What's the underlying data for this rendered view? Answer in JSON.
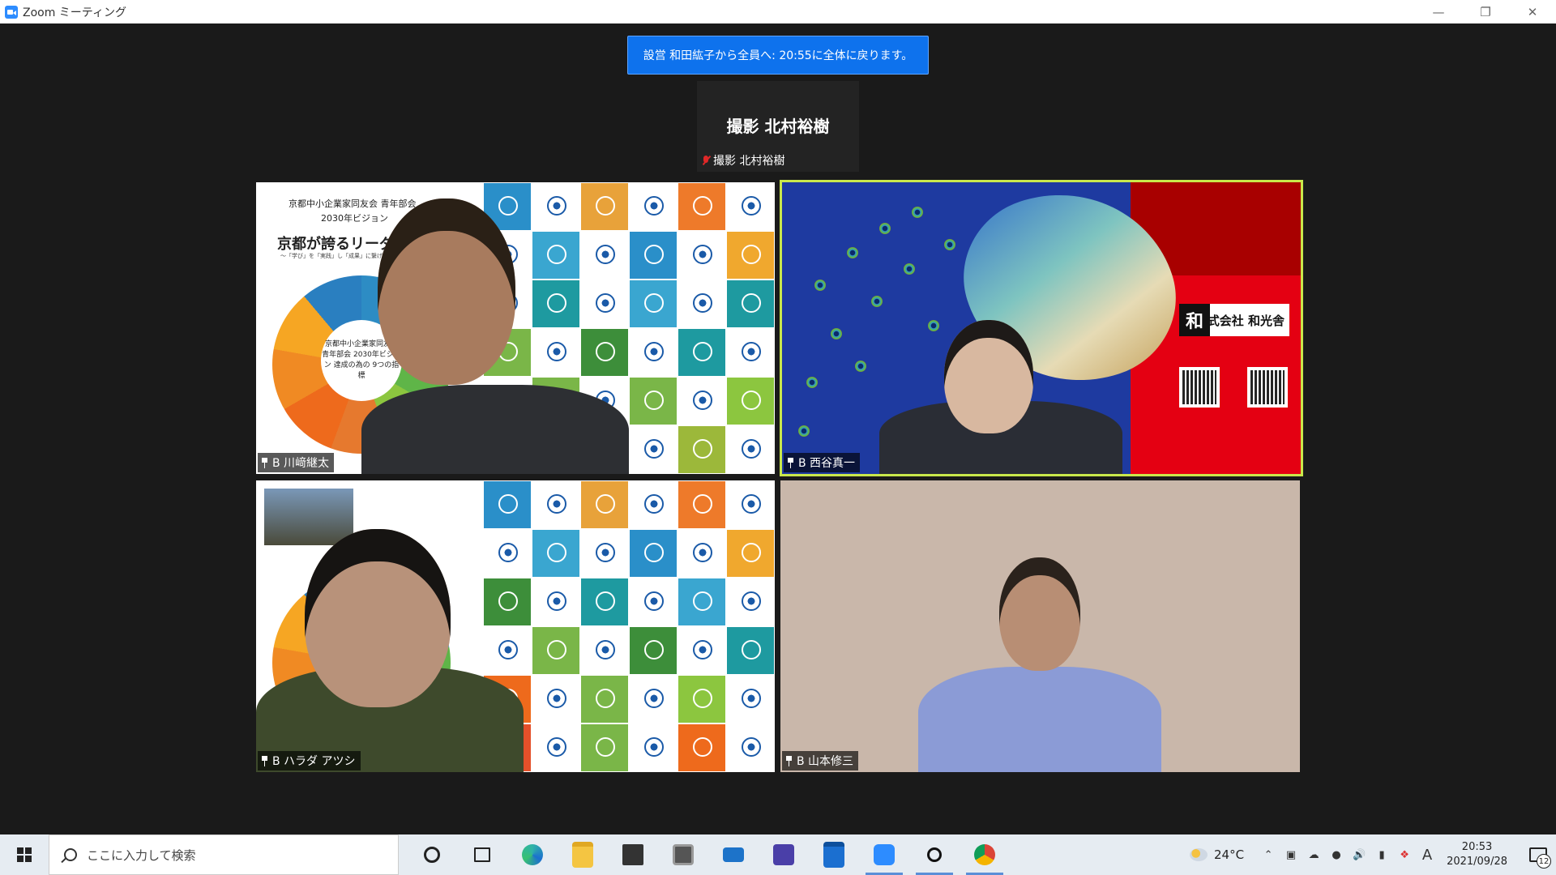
{
  "window": {
    "title": "Zoom ミーティング",
    "controls": [
      "minimize-icon",
      "restore-icon",
      "close-icon"
    ]
  },
  "chat_banner": {
    "text": "設営 和田紘子から全員へ: 20:55に全体に戻ります。"
  },
  "active_speaker": {
    "display_name": "撮影 北村裕樹",
    "label": "撮影 北村裕樹"
  },
  "participants": [
    {
      "name": "B 川﨑継太"
    },
    {
      "name": "B 西谷真一"
    },
    {
      "name": "B ハラダ アツシ"
    },
    {
      "name": "B 山本修三"
    }
  ],
  "slide": {
    "org_line1": "京都中小企業家同友会 青年部会",
    "org_line2": "2030年ビジョン",
    "heading": "京都が誇るリーダーになろう",
    "subheading": "〜「学び」を「実践」し「成果」に繋げ、地域になくてはならない",
    "wheel_center": "京都中小企業家同友会 青年部会 2030年ビジョン 達成の為の 9つの指標"
  },
  "peacock": {
    "logo_text": "株式会社 和光舎",
    "logo_mark": "和"
  },
  "taskbar": {
    "search_placeholder": "ここに入力して検索",
    "weather": "24°C",
    "time": "20:53",
    "date": "2021/09/28",
    "notification_count": "12",
    "ime": "A",
    "apps": [
      "cortana-icon",
      "task-view-icon",
      "edge-icon",
      "file-explorer-icon",
      "store-icon",
      "photos-icon",
      "mail-icon",
      "app-icon",
      "calendar-icon",
      "zoom-icon",
      "app-icon",
      "chrome-icon"
    ]
  },
  "colors": {
    "chat_banner": "#0e72ed",
    "active_border": "#c9e84b",
    "window_bg": "#1a1a1a"
  }
}
